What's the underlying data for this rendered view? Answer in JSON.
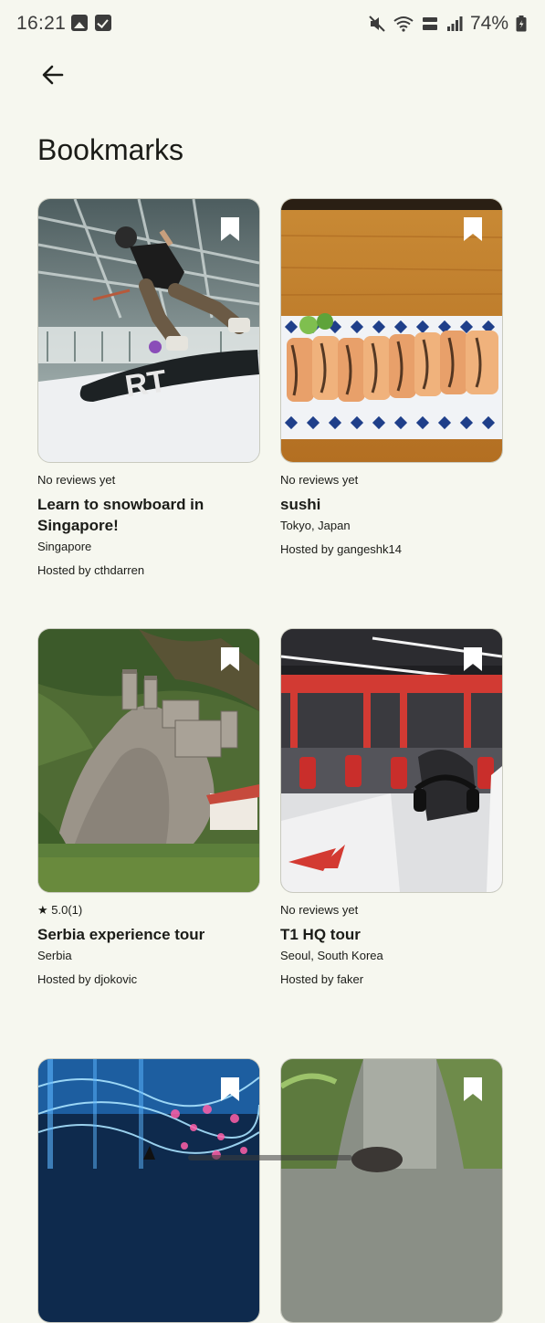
{
  "status_bar": {
    "time": "16:21",
    "battery": "74%"
  },
  "header": {
    "title": "Bookmarks"
  },
  "cards": [
    {
      "rating": "No reviews yet",
      "title": "Learn to snowboard in Singapore!",
      "location": "Singapore",
      "host": "Hosted by cthdarren"
    },
    {
      "rating": "No reviews yet",
      "title": "sushi",
      "location": "Tokyo, Japan",
      "host": "Hosted by gangeshk14"
    },
    {
      "rating": "★ 5.0(1)",
      "title": "Serbia experience tour",
      "location": "Serbia",
      "host": "Hosted by djokovic"
    },
    {
      "rating": "No reviews yet",
      "title": "T1 HQ tour",
      "location": "Seoul, South Korea",
      "host": "Hosted by faker"
    }
  ],
  "colors": {
    "background": "#f6f7ef",
    "text": "#1b1c18",
    "bookmark_fill": "#ffffff"
  },
  "icons": {
    "back": "arrow-left-icon",
    "bookmark": "bookmark-filled-icon"
  }
}
